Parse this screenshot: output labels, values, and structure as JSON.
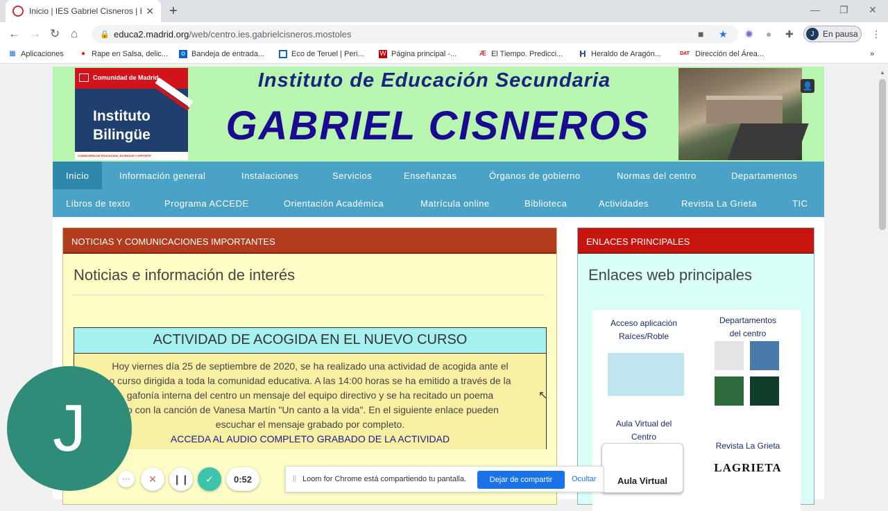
{
  "browser": {
    "tab_title": "Inicio | IES Gabriel Cisneros | Edu",
    "url_host": "educa2.madrid.org",
    "url_path": "/web/centro.ies.gabrielcisneros.mostoles",
    "profile_initial": "J",
    "profile_label": "En pausa"
  },
  "bookmarks": [
    {
      "label": "Aplicaciones",
      "icon": "apps-grid-icon"
    },
    {
      "label": "Rape en Salsa, delic...",
      "icon": "chili-icon"
    },
    {
      "label": "Bandeja de entrada...",
      "icon": "outlook-icon"
    },
    {
      "label": "Eco de Teruel | Peri...",
      "icon": "news-icon"
    },
    {
      "label": "Página principal -...",
      "icon": "wiki-icon"
    },
    {
      "label": "El Tiempo. Predicci...",
      "icon": "weather-icon"
    },
    {
      "label": "Heraldo de Aragón...",
      "icon": "heraldo-icon"
    },
    {
      "label": "Dirección del Área...",
      "icon": "dat-icon"
    }
  ],
  "header": {
    "logo_top": "Comunidad de Madrid",
    "logo_line1": "Instituto",
    "logo_line2": "Bilingüe",
    "logo_footer": "CONSEJERÍA DE EDUCACIÓN, JUVENTUD Y DEPORTE",
    "title_line1": "Instituto de Educación Secundaria",
    "title_line2": "GABRIEL CISNEROS"
  },
  "menu": {
    "row1": [
      "Inicio",
      "Información general",
      "Instalaciones",
      "Servicios",
      "Enseñanzas",
      "Órganos de gobierno",
      "Normas del centro",
      "Departamentos"
    ],
    "row2": [
      "Libros de texto",
      "Programa ACCEDE",
      "Orientación Académica",
      "Matrícula online",
      "Biblioteca",
      "Actividades",
      "Revista La Grieta",
      "TIC"
    ]
  },
  "news_panel": {
    "heading": "NOTICIAS Y COMUNICACIONES IMPORTANTES",
    "subtitle": "Noticias e información de interés",
    "item_title": "ACTIVIDAD DE ACOGIDA EN EL NUEVO CURSO",
    "item_line1": "Hoy viernes día 25 de septiembre de 2020, se ha realizado una actividad de acogida ante el",
    "item_line2": "o curso dirigida a toda la comunidad educativa. A las 14:00 horas se ha emitido a través de la",
    "item_line3": "gafonía interna del centro un mensaje del equipo directivo y se ha recitado un poema",
    "item_line4": "do con la canción de Vanesa Martín \"Un canto a la vida\". En el siguiente enlace pueden",
    "item_line5": "escuchar el mensaje grabado por completo.",
    "item_link": "ACCEDA AL AUDIO COMPLETO GRABADO DE LA ACTIVIDAD"
  },
  "links_panel": {
    "heading": "ENLACES PRINCIPALES",
    "subtitle": "Enlaces web principales",
    "link1": "Acceso aplicación Raíces/Roble",
    "link2_a": "Departamentos",
    "link2_b": "del centro",
    "link3_a": "Aula Virtual del",
    "link3_b": "Centro",
    "link3_logo": "Aula Virtual",
    "link4": "Revista La Grieta",
    "link4_logo": "LAGRIETA"
  },
  "recorder": {
    "avatar_initial": "J",
    "timer": "0:52",
    "share_message": "Loom for Chrome está compartiendo tu pantalla.",
    "stop_label": "Dejar de compartir",
    "hide_label": "Ocultar"
  }
}
